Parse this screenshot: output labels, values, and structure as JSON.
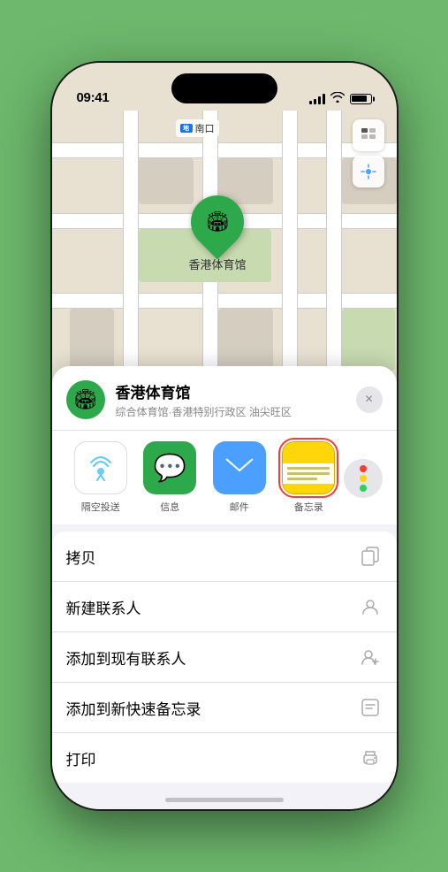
{
  "status_bar": {
    "time": "09:41",
    "location_icon": "▶"
  },
  "map": {
    "label": "南口",
    "pin_label": "香港体育馆",
    "pin_emoji": "🏟️"
  },
  "sheet": {
    "title": "香港体育馆",
    "subtitle": "综合体育馆·香港特别行政区 油尖旺区",
    "close_label": "×"
  },
  "share_items": [
    {
      "id": "airdrop",
      "label": "隔空投送",
      "selected": false
    },
    {
      "id": "messages",
      "label": "信息",
      "selected": false
    },
    {
      "id": "mail",
      "label": "邮件",
      "selected": false
    },
    {
      "id": "notes",
      "label": "备忘录",
      "selected": true
    }
  ],
  "actions": [
    {
      "id": "copy",
      "label": "拷贝",
      "icon": "⧉"
    },
    {
      "id": "add-contact",
      "label": "新建联系人",
      "icon": "👤"
    },
    {
      "id": "add-existing",
      "label": "添加到现有联系人",
      "icon": "👤"
    },
    {
      "id": "add-notes",
      "label": "添加到新快速备忘录",
      "icon": "🗒"
    },
    {
      "id": "print",
      "label": "打印",
      "icon": "🖨"
    }
  ],
  "colors": {
    "green": "#2da84a",
    "blue": "#4a9fff",
    "red": "#ff3b30",
    "yellow": "#ffd60a"
  }
}
